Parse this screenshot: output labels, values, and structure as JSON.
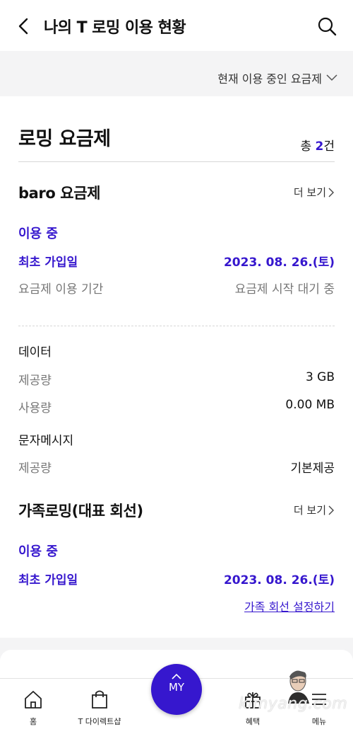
{
  "header": {
    "title": "나의 T 로밍 이용 현황"
  },
  "filter": {
    "label": "현재 이용 중인 요금제"
  },
  "roaming": {
    "section_title": "로밍 요금제",
    "count_prefix": "총 ",
    "count_num": "2",
    "count_suffix": "건",
    "plans": [
      {
        "name": "baro 요금제",
        "more": "더 보기",
        "status": "이용 중",
        "join_label": "최초 가입일",
        "join_date": "2023. 08. 26.(토)",
        "period_label": "요금제 이용 기간",
        "period_value": "요금제 시작 대기 중",
        "data_title": "데이터",
        "data_provided_label": "제공량",
        "data_provided_value": "3 GB",
        "data_used_label": "사용량",
        "data_used_value": "0.00 MB",
        "sms_title": "문자메시지",
        "sms_provided_label": "제공량",
        "sms_provided_value": "기본제공"
      },
      {
        "name": "가족로밍(대표 회선)",
        "more": "더 보기",
        "status": "이용 중",
        "join_label": "최초 가입일",
        "join_date": "2023. 08. 26.(토)",
        "link": "가족 회선 설정하기"
      }
    ]
  },
  "tabbar": {
    "home": "홈",
    "shop": "T 다이렉트샵",
    "my": "MY",
    "benefit": "혜택",
    "menu": "메뉴"
  },
  "watermark": "kimyang.com",
  "colors": {
    "accent": "#3617ce",
    "bg_gray": "#f4f4f5"
  }
}
